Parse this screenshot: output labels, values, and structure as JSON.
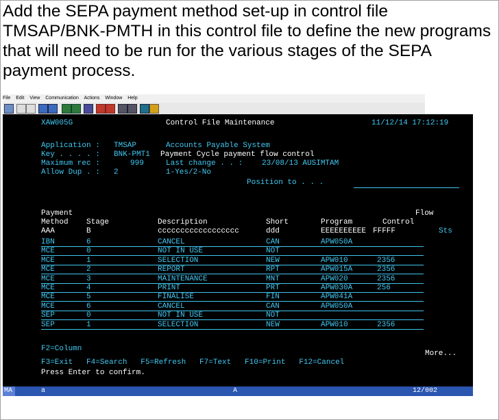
{
  "instruction": "Add the SEPA payment method set-up in control file TMSAP/BNK-PMTH in this control file to define the new programs that will need to be run for the various stages of the SEPA payment process.",
  "menu": [
    "File",
    "Edit",
    "View",
    "Communication",
    "Actions",
    "Window",
    "Help"
  ],
  "header": {
    "program_id": "XAW005G",
    "title": "Control File Maintenance",
    "datetime": "11/12/14 17:12:19"
  },
  "info": {
    "application_label": "Application :",
    "application_value": "TMSAP",
    "application_desc": "Accounts Payable System",
    "key_label": "Key . . . . :",
    "key_value": "BNK-PMT1",
    "key_desc": "Payment Cycle payment flow control",
    "maxrec_label": "Maximum rec :",
    "maxrec_value": "999",
    "last_change_label": "Last change . . :",
    "last_change_value": "23/08/13 AUSIMTAM",
    "allowdup_label": "Allow Dup . :",
    "allowdup_value": "2",
    "allowdup_desc": "1-Yes/2-No",
    "position_label": "Position to . . ."
  },
  "columns": {
    "payment": "Payment",
    "method": "Method",
    "stage": "Stage",
    "description": "Description",
    "short": "Short",
    "program": "Program",
    "flow": "Flow",
    "control": "Control",
    "method_fmt": "AAA",
    "stage_fmt": "B",
    "description_fmt": "cccccccccccccccccc",
    "short_fmt": "ddd",
    "program_fmt": "EEEEEEEEEE",
    "control_fmt": "FFFFF",
    "sts": "Sts"
  },
  "rows": [
    {
      "method": "IBN",
      "stage": "6",
      "description": "CANCEL",
      "short": "CAN",
      "program": "APW050A",
      "control": ""
    },
    {
      "method": "MCE",
      "stage": "0",
      "description": "NOT IN USE",
      "short": "NOT",
      "program": "",
      "control": ""
    },
    {
      "method": "MCE",
      "stage": "1",
      "description": "SELECTION",
      "short": "NEW",
      "program": "APW010",
      "control": "2356"
    },
    {
      "method": "MCE",
      "stage": "2",
      "description": "REPORT",
      "short": "RPT",
      "program": "APW015A",
      "control": "2356"
    },
    {
      "method": "MCE",
      "stage": "3",
      "description": "MAINTENANCE",
      "short": "MNT",
      "program": "APW020",
      "control": "2356"
    },
    {
      "method": "MCE",
      "stage": "4",
      "description": "PRINT",
      "short": "PRT",
      "program": "APW030A",
      "control": "256"
    },
    {
      "method": "MCE",
      "stage": "5",
      "description": "FINALISE",
      "short": "FIN",
      "program": "APW041A",
      "control": ""
    },
    {
      "method": "MCE",
      "stage": "6",
      "description": "CANCEL",
      "short": "CAN",
      "program": "APW050A",
      "control": ""
    },
    {
      "method": "SEP",
      "stage": "0",
      "description": "NOT IN USE",
      "short": "NOT",
      "program": "",
      "control": ""
    },
    {
      "method": "SEP",
      "stage": "1",
      "description": "SELECTION",
      "short": "NEW",
      "program": "APW010",
      "control": "2356"
    }
  ],
  "footer": {
    "f2": "F2=Column",
    "more": "More...",
    "fkeys": "F3=Exit   F4=Search   F5=Refresh   F7=Text   F10=Print   F12=Cancel",
    "prompt": "Press Enter to confirm."
  },
  "status": {
    "ma": "MA",
    "a_left": "a",
    "a_mid": "A",
    "cursor": "12/002"
  },
  "colors": {
    "terminal_bg": "#000000",
    "terminal_text": "#41c8f2",
    "highlight_text": "#ffffff",
    "statusbar_bg": "#2a55b0"
  }
}
